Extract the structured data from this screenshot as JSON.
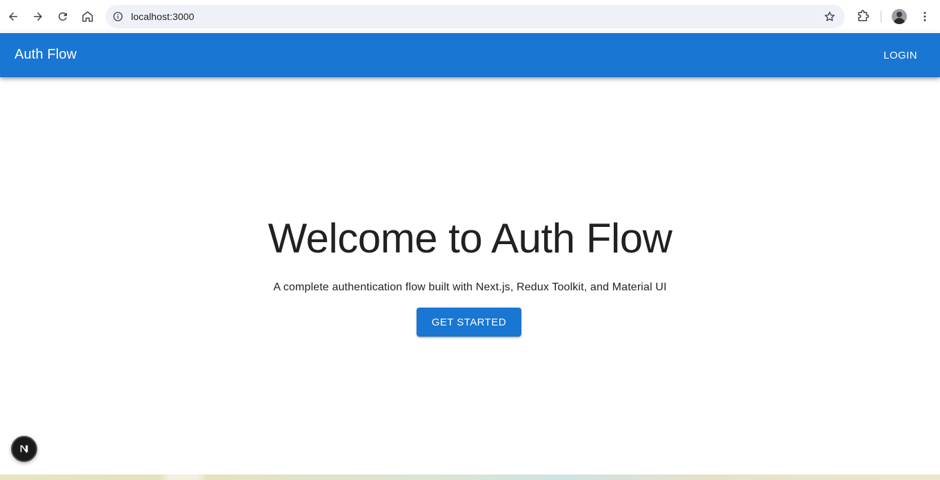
{
  "browser": {
    "url": "localhost:3000"
  },
  "app": {
    "title": "Auth Flow",
    "login_label": "LOGIN"
  },
  "hero": {
    "title": "Welcome to Auth Flow",
    "subtitle": "A complete authentication flow built with Next.js, Redux Toolkit, and Material UI",
    "cta_label": "GET STARTED"
  },
  "dev_indicator": {
    "letter": "N"
  },
  "colors": {
    "primary": "#1976d2",
    "omnibox_bg": "#eef1f8",
    "text": "#212121"
  }
}
